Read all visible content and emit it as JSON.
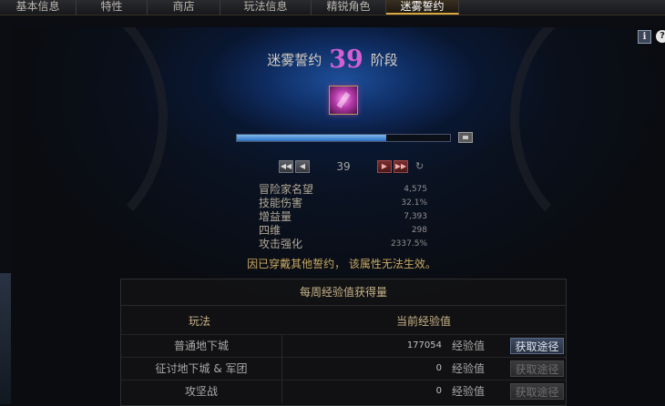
{
  "tabs": [
    {
      "label": "基本信息",
      "active": false
    },
    {
      "label": "特性",
      "active": false
    },
    {
      "label": "商店",
      "active": false
    },
    {
      "label": "玩法信息",
      "active": false
    },
    {
      "label": "精锐角色",
      "active": false
    },
    {
      "label": "迷雾誓约",
      "active": true
    }
  ],
  "header": {
    "title_prefix": "迷雾誓约",
    "stage": "39",
    "title_suffix": "阶段"
  },
  "progress": {
    "fraction": 0.7
  },
  "pager": {
    "current": "39"
  },
  "stats": [
    {
      "label": "冒险家名望",
      "value": "4,575"
    },
    {
      "label": "技能伤害",
      "value": "32.1%"
    },
    {
      "label": "增益量",
      "value": "7,393"
    },
    {
      "label": "四维",
      "value": "298"
    },
    {
      "label": "攻击强化",
      "value": "2337.5%"
    }
  ],
  "warning": "因已穿戴其他誓约， 该属性无法生效。",
  "panel": {
    "title": "每周经验值获得量",
    "col_mode": "玩法",
    "col_exp": "当前经验值",
    "rows": [
      {
        "mode": "普通地下城",
        "value": "177054",
        "unit": "经验值",
        "button": "获取途径",
        "enabled": true
      },
      {
        "mode": "征讨地下城 & 军团",
        "value": "0",
        "unit": "经验值",
        "button": "获取途径",
        "enabled": false
      },
      {
        "mode": "攻坚战",
        "value": "0",
        "unit": "经验值",
        "button": "获取途径",
        "enabled": false
      }
    ]
  },
  "icons": {
    "info": "i",
    "help": "?"
  },
  "colors": {
    "stage_number": "#d45ed3",
    "accent_gold": "#d8a640",
    "warning": "#c9a962"
  }
}
